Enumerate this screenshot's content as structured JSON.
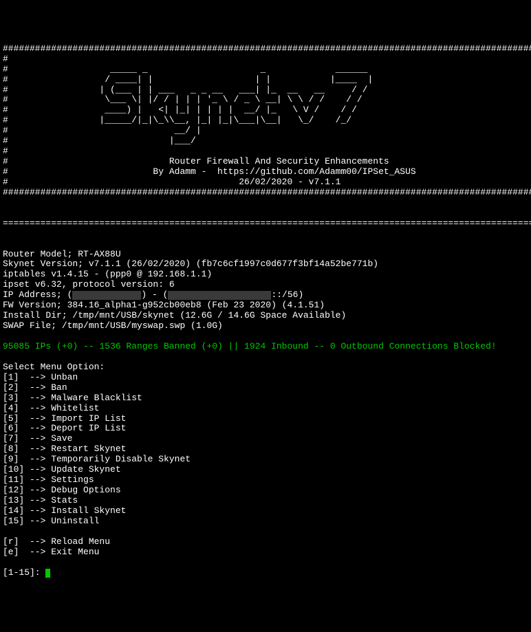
{
  "banner": {
    "border_full": "#############################################################################################################",
    "side": "#                                                                                                           #",
    "ascii": [
      "#                   _____ _                     _             ______                                        #",
      "#                  / ____| |                   | |           |____  |                                       #",
      "#                 | (___ | | ___   _ _ __   ___| |_  __   __     / /                                        #",
      "#                  \\___ \\| |/ / | | | '_ \\ / _ \\ __| \\ \\ / /    / /                                         #",
      "#                  ____) |   <| |_| | | | |  __/ |_   \\ V /    / /                                          #",
      "#                 |_____/|_|\\_\\\\__, |_| |_|\\___|\\__|   \\_/    /_/                                           #",
      "#                               __/ |                                                                       #",
      "#                              |___/                                                                        #",
      "#                                                                                                           #"
    ],
    "subtitle1": "#                              Router Firewall And Security Enhancements                                    #",
    "subtitle2": "#                           By Adamm -  https://github.com/Adamm00/IPSet_ASUS                               #",
    "subtitle3": "#                                           26/02/2020 - v7.1.1                                             #"
  },
  "divider": "=============================================================================================================",
  "info": {
    "router_model": "Router Model; RT-AX88U",
    "skynet_version": "Skynet Version; v7.1.1 (26/02/2020) (fb7c6cf1997c0d677f3bf14a52be771b)",
    "iptables": "iptables v1.4.15 - (ppp0 @ 192.168.1.1)",
    "ipset": "ipset v6.32, protocol version: 6",
    "ip_prefix": "IP Address; (",
    "ip_mid": ") - (",
    "ip_suffix": "::/56)",
    "fw_version": "FW Version; 384.16_alpha1-g952cb00eb8 (Feb 23 2020) (4.1.51)",
    "install_dir": "Install Dir; /tmp/mnt/USB/skynet (12.6G / 14.6G Space Available)",
    "swap_file": "SWAP File; /tmp/mnt/USB/myswap.swp (1.0G)"
  },
  "status": "95085 IPs (+0) -- 1536 Ranges Banned (+0) || 1924 Inbound -- 0 Outbound Connections Blocked!",
  "menu": {
    "header": "Select Menu Option:",
    "items": [
      "[1]  --> Unban",
      "[2]  --> Ban",
      "[3]  --> Malware Blacklist",
      "[4]  --> Whitelist",
      "[5]  --> Import IP List",
      "[6]  --> Deport IP List",
      "[7]  --> Save",
      "[8]  --> Restart Skynet",
      "[9]  --> Temporarily Disable Skynet",
      "[10] --> Update Skynet",
      "[11] --> Settings",
      "[12] --> Debug Options",
      "[13] --> Stats",
      "[14] --> Install Skynet",
      "[15] --> Uninstall"
    ],
    "reload": "[r]  --> Reload Menu",
    "exit": "[e]  --> Exit Menu"
  },
  "prompt": "[1-15]: "
}
